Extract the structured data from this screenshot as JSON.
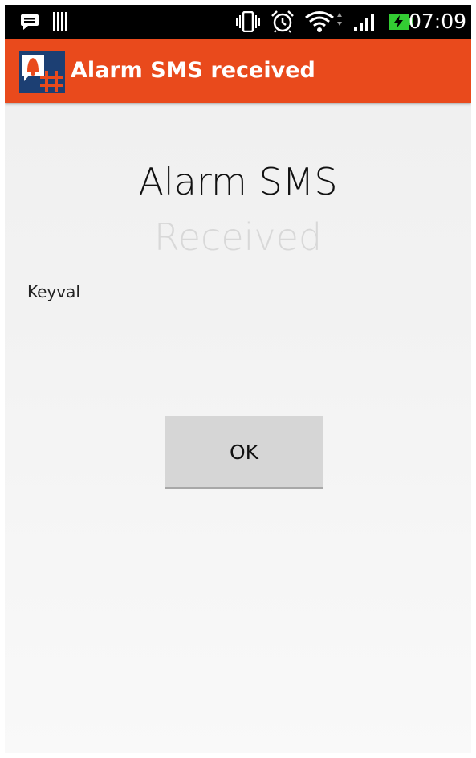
{
  "status_bar": {
    "time": "07:09",
    "icons": [
      "message-icon",
      "barcode-icon",
      "vibrate-icon",
      "alarm-clock-icon",
      "wifi-icon",
      "signal-icon",
      "battery-charging-icon"
    ]
  },
  "app_bar": {
    "title": "Alarm SMS received",
    "background_color": "#e94a1c"
  },
  "content": {
    "heading": "Alarm SMS",
    "subheading": "Received",
    "sender": "Keyval",
    "ok_label": "OK"
  }
}
